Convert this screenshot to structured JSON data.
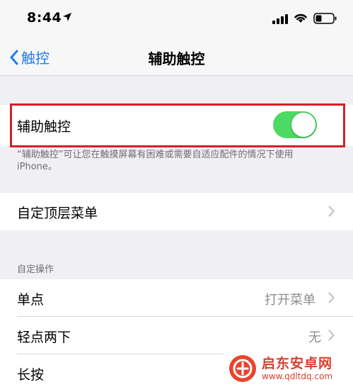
{
  "status_bar": {
    "time": "8:44"
  },
  "nav": {
    "back_label": "触控",
    "title": "辅助触控"
  },
  "assistive_touch": {
    "label": "辅助触控",
    "enabled": true
  },
  "footnote": "“辅助触控”可让您在触摸屏幕有困难或需要自适应配件的情况下使用 iPhone。",
  "top_menu": {
    "label": "自定顶层菜单"
  },
  "custom_actions": {
    "header": "自定操作",
    "items": [
      {
        "label": "单点",
        "value": "打开菜单"
      },
      {
        "label": "轻点两下",
        "value": "无"
      },
      {
        "label": "长按",
        "value": ""
      }
    ]
  },
  "watermark": {
    "name": "启东安卓网",
    "url": "www.qdltdq.com"
  },
  "colors": {
    "accent": "#1e7cf5",
    "toggle_on": "#4cd964",
    "highlight": "#d3202a"
  }
}
